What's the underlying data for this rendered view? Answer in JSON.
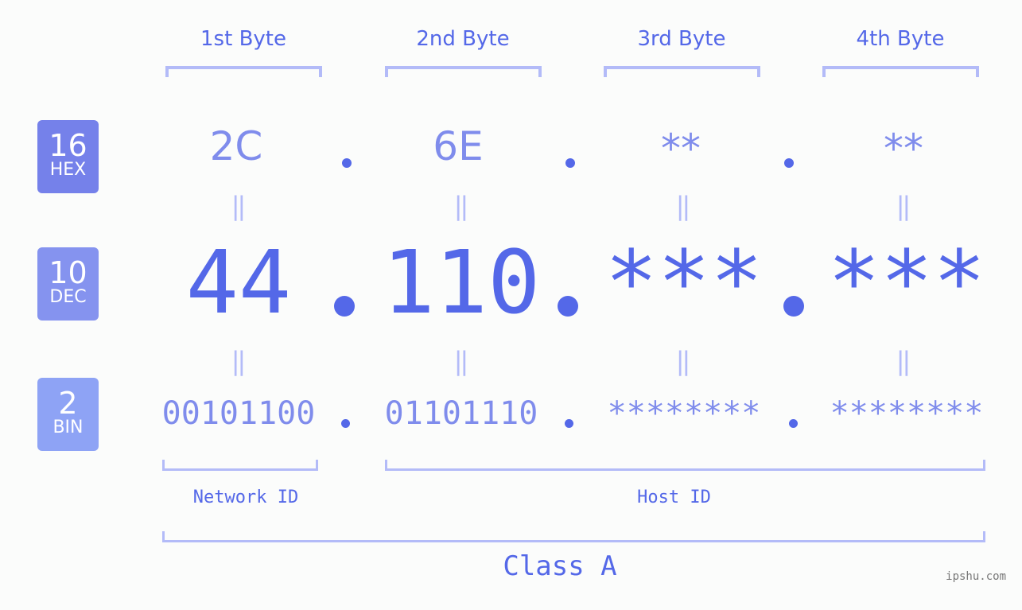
{
  "bytes": [
    {
      "title": "1st Byte",
      "hex": "2C",
      "dec": "44",
      "bin": "00101100"
    },
    {
      "title": "2nd Byte",
      "hex": "6E",
      "dec": "110",
      "bin": "01101110"
    },
    {
      "title": "3rd Byte",
      "hex": "**",
      "dec": "***",
      "bin": "********"
    },
    {
      "title": "4th Byte",
      "hex": "**",
      "dec": "***",
      "bin": "********"
    }
  ],
  "badges": {
    "hex": {
      "num": "16",
      "label": "HEX",
      "color": "#7581ea"
    },
    "dec": {
      "num": "10",
      "label": "DEC",
      "color": "#8593ef"
    },
    "bin": {
      "num": "2",
      "label": "BIN",
      "color": "#8ea3f5"
    }
  },
  "equals_sign": "=",
  "separator": ".",
  "network_id_label": "Network ID",
  "host_id_label": "Host ID",
  "class_label": "Class A",
  "watermark": "ipshu.com",
  "colors": {
    "accent": "#5468e8",
    "light_accent": "#7f8cec",
    "bracket": "#b3bbf8",
    "background": "#fbfcfb"
  }
}
